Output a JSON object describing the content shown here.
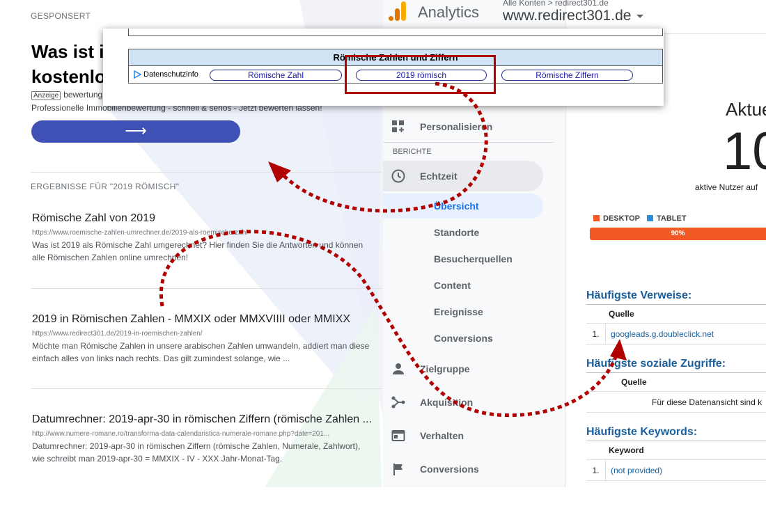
{
  "left": {
    "sponsored_label": "GESPONSERT",
    "ad": {
      "title_line1": "Was ist il",
      "title_line2": "kostenlo",
      "badge": "Anzeige",
      "line": "bewertung",
      "description": "Professionelle Immobilienbewertung - schnell & seriös - Jetzt bewerten lassen!",
      "button_arrow": "⟶"
    },
    "results_header": "ERGEBNISSE FÜR \"2019 RÖMISCH\"",
    "results": [
      {
        "title": "Römische Zahl von 2019",
        "url": "https://www.roemische-zahlen-umrechner.de/2019-als-roemische-zahl",
        "snippet": "Was ist 2019 als Römische Zahl umgerechnet? Hier finden Sie die Antworten und können alle Römischen Zahlen online umrechnen!"
      },
      {
        "title": "2019 in Römischen Zahlen - MMXIX oder MMXVIIII oder MMIXX",
        "url": "https://www.redirect301.de/2019-in-roemischen-zahlen/",
        "snippet": "Möchte man Römische Zahlen in unsere arabischen Zahlen umwandeln, addiert man diese einfach alles von links nach rechts. Das gilt zumindest solange, wie ..."
      },
      {
        "title": "Datumrechner: 2019-apr-30 in römischen Ziffern (römische Zahlen ...",
        "url": "http://www.numere-romane.ro/transforma-data-calendaristica-numerale-romane.php?date=201...",
        "snippet": "Datumrechner: 2019-apr-30 in römischen Ziffern (römische Zahlen, Numerale, Zahlwort), wie schreibt man 2019-apr-30 = MMXIX - IV - XXX Jahr-Monat-Tag."
      }
    ]
  },
  "ga": {
    "brand": "Analytics",
    "account_crumb": "Alle Konten > redirect301.de",
    "account_name": "www.redirect301.de",
    "nav": {
      "personalize": "Personalisieren",
      "section": "BERICHTE",
      "realtime": "Echtzeit",
      "sub": [
        "Übersicht",
        "Standorte",
        "Besucherquellen",
        "Content",
        "Ereignisse",
        "Conversions"
      ],
      "audience": "Zielgruppe",
      "acquisition": "Akquisition",
      "behavior": "Verhalten",
      "conversions": "Conversions"
    },
    "realtime": {
      "title": "Aktue",
      "number": "10",
      "subtitle": "aktive Nutzer auf"
    },
    "legend": [
      {
        "label": "DESKTOP",
        "color": "#f15a24"
      },
      {
        "label": "TABLET",
        "color": "#2a8fd6"
      }
    ],
    "desktop_share": "90%",
    "referrals": {
      "title": "Häufigste Verweise:",
      "header": "Quelle",
      "rows": [
        {
          "num": "1.",
          "value": "googleads.g.doubleclick.net"
        }
      ]
    },
    "social": {
      "title": "Häufigste soziale Zugriffe:",
      "header": "Quelle",
      "empty": "Für diese Datenansicht sind k"
    },
    "keywords": {
      "title": "Häufigste Keywords:",
      "header": "Keyword",
      "rows": [
        {
          "num": "1.",
          "value": "(not provided)"
        }
      ]
    }
  },
  "overlay": {
    "heading": "Römische Zahlen und Ziffern",
    "privacy": "Datenschutzinfo",
    "links": [
      "Römische Zahl",
      "2019 römisch",
      "Römische Ziffern"
    ]
  },
  "colors": {
    "ga_orange": "#f9ab00",
    "annotation_red": "#b00000",
    "ad_button": "#3f51b5"
  }
}
